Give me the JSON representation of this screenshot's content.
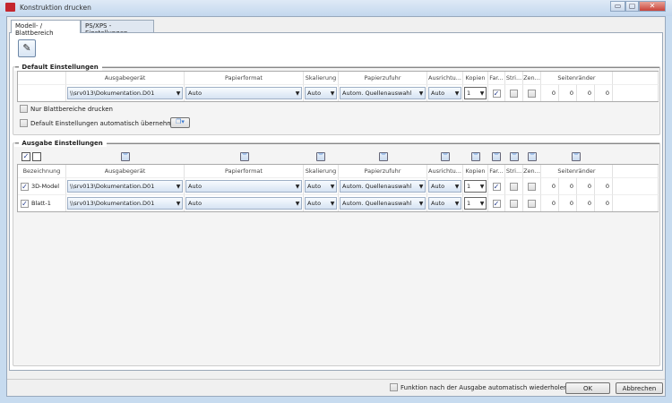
{
  "window": {
    "title": "Konstruktion drucken",
    "minimize": "▭",
    "maximize": "▢",
    "close": "✕"
  },
  "tabs": [
    {
      "label": "Modell- / Blattbereich",
      "active": true
    },
    {
      "label": "PS/XPS - Einstellungen",
      "active": false
    }
  ],
  "columns": [
    "Bezeichnung",
    "Ausgabegerät",
    "Papierformat",
    "Skalierung",
    "Papierzufuhr",
    "Ausrichtu...",
    "Kopien",
    "Far...",
    "Stri...",
    "Zen...",
    "Seitenränder"
  ],
  "default_settings": {
    "title": "Default Einstellungen",
    "row": {
      "device": "\\\\srv013\\Dokumentation.D01",
      "paper": "Auto",
      "scale": "Auto",
      "feed": "Autom. Quellenauswahl",
      "orientation": "Auto",
      "copies": "1",
      "color": true,
      "stri": false,
      "zen": false,
      "margins": [
        "0",
        "0",
        "0",
        "0"
      ]
    },
    "only_sheets": {
      "label": "Nur Blattbereiche drucken",
      "checked": false
    },
    "auto_apply": {
      "label": "Default Einstellungen automatisch übernehmen",
      "checked": false
    }
  },
  "output_settings": {
    "title": "Ausgabe Einstellungen",
    "rows": [
      {
        "name": "3D-Model",
        "checked": true,
        "device": "\\\\srv013\\Dokumentation.D01",
        "paper": "Auto",
        "scale": "Auto",
        "feed": "Autom. Quellenauswahl",
        "orientation": "Auto",
        "copies": "1",
        "color": true,
        "stri": false,
        "zen": false,
        "margins": [
          "0",
          "0",
          "0",
          "0"
        ]
      },
      {
        "name": "Blatt-1",
        "checked": true,
        "device": "\\\\srv013\\Dokumentation.D01",
        "paper": "Auto",
        "scale": "Auto",
        "feed": "Autom. Quellenauswahl",
        "orientation": "Auto",
        "copies": "1",
        "color": true,
        "stri": false,
        "zen": false,
        "margins": [
          "0",
          "0",
          "0",
          "0"
        ]
      }
    ]
  },
  "footer": {
    "repeat_label": "Funktion nach der Ausgabe automatisch wiederholen",
    "repeat_checked": false,
    "ok": "OK",
    "cancel": "Abbrechen"
  },
  "colors": {
    "accent": "#3a7ad0",
    "frame": "#c7dbef",
    "close": "#c9433a"
  }
}
